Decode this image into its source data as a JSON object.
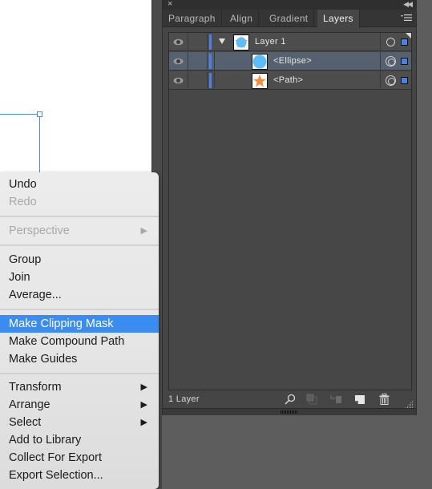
{
  "panel": {
    "close_icon": "×",
    "collapse_icon": "◀◀",
    "tabs": [
      {
        "label": "Paragraph",
        "active": false
      },
      {
        "label": "Align",
        "active": false
      },
      {
        "label": "Gradient",
        "active": false
      },
      {
        "label": "Layers",
        "active": true
      }
    ],
    "menu_icon": "☰",
    "layers": [
      {
        "name": "Layer 1",
        "type": "layer",
        "expanded": true,
        "selected": false,
        "thumbnail": "circle-with-star",
        "target": "single"
      },
      {
        "name": "<Ellipse>",
        "type": "ellipse",
        "selected": true,
        "thumbnail": "circle",
        "target": "double"
      },
      {
        "name": "<Path>",
        "type": "path",
        "selected": false,
        "thumbnail": "star",
        "target": "double"
      }
    ],
    "layer_color": "#4a7ff0",
    "footer": {
      "count_label": "1 Layer",
      "icons": [
        "search-icon",
        "make-clipping-mask-icon",
        "create-sublayer-icon",
        "new-layer-icon",
        "trash-icon"
      ]
    }
  },
  "context_menu": {
    "items": [
      {
        "label": "Undo",
        "disabled": false
      },
      {
        "label": "Redo",
        "disabled": true
      },
      {
        "label": "Perspective",
        "disabled": true,
        "submenu": true
      },
      {
        "label": "Group",
        "disabled": false
      },
      {
        "label": "Join",
        "disabled": false
      },
      {
        "label": "Average...",
        "disabled": false
      },
      {
        "label": "Make Clipping Mask",
        "disabled": false,
        "highlighted": true
      },
      {
        "label": "Make Compound Path",
        "disabled": false
      },
      {
        "label": "Make Guides",
        "disabled": false
      },
      {
        "label": "Transform",
        "disabled": false,
        "submenu": true
      },
      {
        "label": "Arrange",
        "disabled": false,
        "submenu": true
      },
      {
        "label": "Select",
        "disabled": false,
        "submenu": true
      },
      {
        "label": "Add to Library",
        "disabled": false
      },
      {
        "label": "Collect For Export",
        "disabled": false
      },
      {
        "label": "Export Selection...",
        "disabled": false
      }
    ],
    "submenu_arrow": "▶",
    "highlight_color": "#3b8cf0"
  }
}
